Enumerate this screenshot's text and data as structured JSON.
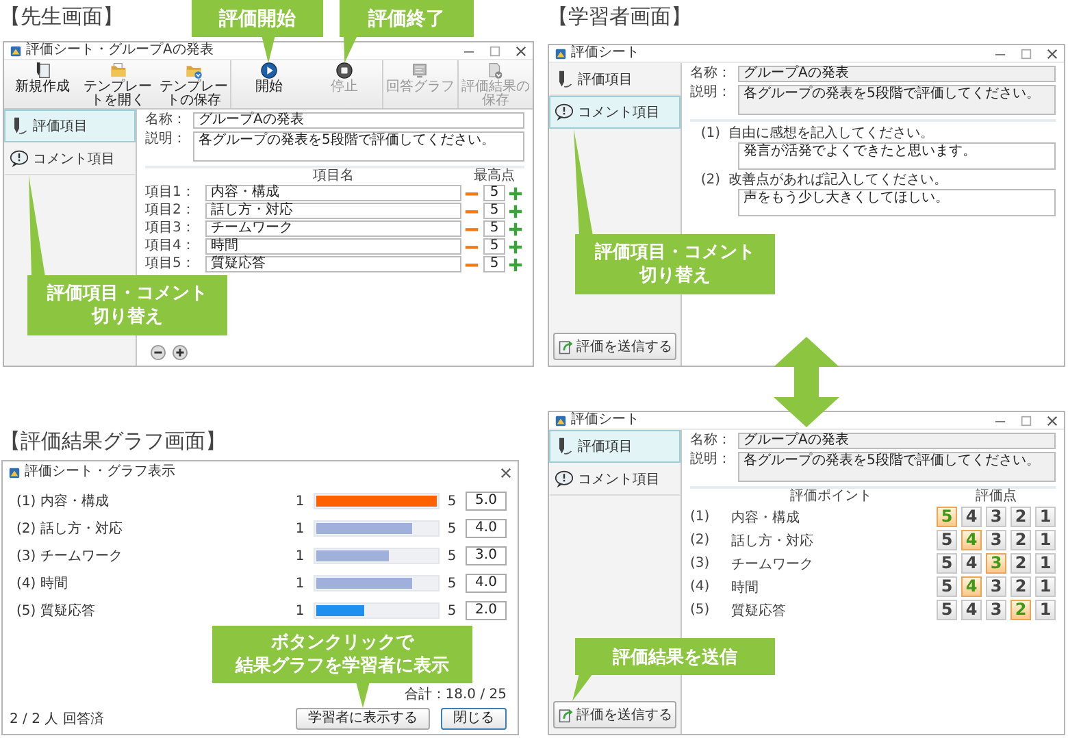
{
  "teacher_screen": {
    "heading": "【先生画面】",
    "window": {
      "title": "評価シート・グループAの発表",
      "toolbar": [
        {
          "label": "新規作成",
          "disabled": false
        },
        {
          "label": "テンプレートを開く",
          "disabled": false
        },
        {
          "label": "テンプレートの保存",
          "disabled": false
        },
        {
          "label": "開始",
          "disabled": false
        },
        {
          "label": "停止",
          "disabled": true
        },
        {
          "label": "回答グラフ",
          "disabled": true
        },
        {
          "label": "評価結果の保存",
          "disabled": true
        }
      ],
      "sidebar": [
        {
          "label": "評価項目",
          "selected": true
        },
        {
          "label": "コメント項目",
          "selected": false
        }
      ],
      "name_label": "名称：",
      "name_value": "グループAの発表",
      "description_label": "説明：",
      "description_value": "各グループの発表を5段階で評価してください。",
      "columns": [
        "項目名",
        "最高点"
      ],
      "items": [
        {
          "label": "項目1：",
          "name": "内容・構成",
          "max_score": "5"
        },
        {
          "label": "項目2：",
          "name": "話し方・対応",
          "max_score": "5"
        },
        {
          "label": "項目3：",
          "name": "チームワーク",
          "max_score": "5"
        },
        {
          "label": "項目4：",
          "name": "時間",
          "max_score": "5"
        },
        {
          "label": "項目5：",
          "name": "質疑応答",
          "max_score": "5"
        }
      ]
    }
  },
  "student_screen": {
    "heading": "【学習者画面】",
    "window": {
      "title": "評価シート",
      "sidebar": [
        {
          "label": "評価項目",
          "selected": false
        },
        {
          "label": "コメント項目",
          "selected": true
        }
      ],
      "name_label": "名称：",
      "name_value": "グループAの発表",
      "description_label": "説明：",
      "description_value": "各グループの発表を5段階で評価してください。",
      "questions": [
        {
          "number": "(1)",
          "prompt": "自由に感想を記入してください。",
          "answer": "発言が活発でよくできたと思います。"
        },
        {
          "number": "(2)",
          "prompt": "改善点があれば記入してください。",
          "answer": "声をもう少し大きくしてほしい。"
        }
      ],
      "send_button": "評価を送信する"
    }
  },
  "graph_screen": {
    "heading": "【評価結果グラフ画面】",
    "window": {
      "title": "評価シート・グラフ表示",
      "rows": [
        {
          "label": "(1) 内容・構成",
          "min": "1",
          "max": "5",
          "level": 1,
          "color": "#ff6000",
          "value": "5.0"
        },
        {
          "label": "(2) 話し方・対応",
          "min": "1",
          "max": "5",
          "level": 0.8,
          "color": "#9fb1db",
          "value": "4.0"
        },
        {
          "label": "(3) チームワーク",
          "min": "1",
          "max": "5",
          "level": 0.6,
          "color": "#9fb1db",
          "value": "3.0"
        },
        {
          "label": "(4) 時間",
          "min": "1",
          "max": "5",
          "level": 0.8,
          "color": "#9fb1db",
          "value": "4.0"
        },
        {
          "label": "(5) 質疑応答",
          "min": "1",
          "max": "5",
          "level": 0.4,
          "color": "#1e90f0",
          "value": "2.0"
        }
      ],
      "total": "合計：18.0 / 25",
      "respondents": "2 / 2 人 回答済",
      "buttons": [
        {
          "label": "学習者に表示する",
          "default": false
        },
        {
          "label": "閉じる",
          "default": true
        }
      ]
    }
  },
  "rating_screen": {
    "window": {
      "title": "評価シート",
      "sidebar": [
        {
          "label": "評価項目",
          "selected": true
        },
        {
          "label": "コメント項目",
          "selected": false
        }
      ],
      "name_label": "名称：",
      "name_value": "グループAの発表",
      "description_label": "説明：",
      "description_value": "各グループの発表を5段階で評価してください。",
      "columns": [
        "評価ポイント",
        "評価点"
      ],
      "rows": [
        {
          "number": "(1)",
          "name": "内容・構成",
          "scores": [
            {
              "label": "5",
              "selected": true
            },
            {
              "label": "4",
              "selected": false
            },
            {
              "label": "3",
              "selected": false
            },
            {
              "label": "2",
              "selected": false
            },
            {
              "label": "1",
              "selected": false
            }
          ]
        },
        {
          "number": "(2)",
          "name": "話し方・対応",
          "scores": [
            {
              "label": "5",
              "selected": false
            },
            {
              "label": "4",
              "selected": true
            },
            {
              "label": "3",
              "selected": false
            },
            {
              "label": "2",
              "selected": false
            },
            {
              "label": "1",
              "selected": false
            }
          ]
        },
        {
          "number": "(3)",
          "name": "チームワーク",
          "scores": [
            {
              "label": "5",
              "selected": false
            },
            {
              "label": "4",
              "selected": false
            },
            {
              "label": "3",
              "selected": true
            },
            {
              "label": "2",
              "selected": false
            },
            {
              "label": "1",
              "selected": false
            }
          ]
        },
        {
          "number": "(4)",
          "name": "時間",
          "scores": [
            {
              "label": "5",
              "selected": false
            },
            {
              "label": "4",
              "selected": true
            },
            {
              "label": "3",
              "selected": false
            },
            {
              "label": "2",
              "selected": false
            },
            {
              "label": "1",
              "selected": false
            }
          ]
        },
        {
          "number": "(5)",
          "name": "質疑応答",
          "scores": [
            {
              "label": "5",
              "selected": false
            },
            {
              "label": "4",
              "selected": false
            },
            {
              "label": "3",
              "selected": false
            },
            {
              "label": "2",
              "selected": true
            },
            {
              "label": "1",
              "selected": false
            }
          ]
        }
      ],
      "send_button": "評価を送信する"
    }
  },
  "callouts": [
    {
      "lines": [
        "評価開始"
      ]
    },
    {
      "lines": [
        "評価終了"
      ]
    },
    {
      "lines": [
        "評価項目・コメント",
        "切り替え"
      ]
    },
    {
      "lines": [
        "評価項目・コメント",
        "切り替え"
      ]
    },
    {
      "lines": [
        "ボタンクリックで",
        "結果グラフを学習者に表示"
      ]
    },
    {
      "lines": [
        "評価結果を送信"
      ]
    }
  ]
}
